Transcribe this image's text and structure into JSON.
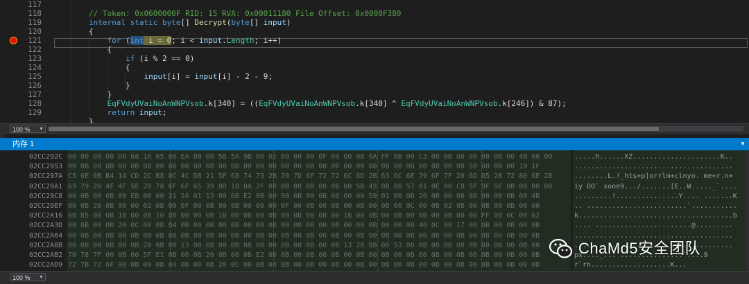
{
  "editor": {
    "lines": [
      {
        "num": "117",
        "tokens": []
      },
      {
        "num": "118",
        "tokens": [
          {
            "t": "// Token: 0x0600000F RID: 15 RVA: 0x00011180 File Offset: 0x0000F380",
            "c": "cm"
          }
        ]
      },
      {
        "num": "119",
        "tokens": [
          {
            "t": "internal static ",
            "c": "kw"
          },
          {
            "t": "byte",
            "c": "kw"
          },
          {
            "t": "[] ",
            "c": ""
          },
          {
            "t": "Decrypt",
            "c": "fn"
          },
          {
            "t": "(",
            "c": ""
          },
          {
            "t": "byte",
            "c": "kw"
          },
          {
            "t": "[] ",
            "c": ""
          },
          {
            "t": "input",
            "c": "id"
          },
          {
            "t": ")",
            "c": ""
          }
        ]
      },
      {
        "num": "120",
        "tokens": [
          {
            "t": "{",
            "c": ""
          }
        ]
      },
      {
        "num": "121",
        "tokens": [
          {
            "t": "    for ",
            "c": "kw"
          },
          {
            "t": "(",
            "c": ""
          },
          {
            "t": "int",
            "c": "kw hl"
          },
          {
            "t": " i = 0",
            "c": "hl2"
          },
          {
            "t": "; i < ",
            "c": ""
          },
          {
            "t": "input",
            "c": "id"
          },
          {
            "t": ".",
            "c": ""
          },
          {
            "t": "Length",
            "c": "ty"
          },
          {
            "t": "; i++)",
            "c": ""
          }
        ]
      },
      {
        "num": "122",
        "tokens": [
          {
            "t": "    {",
            "c": ""
          }
        ]
      },
      {
        "num": "123",
        "tokens": [
          {
            "t": "        if ",
            "c": "kw"
          },
          {
            "t": "(i % 2 == 0)",
            "c": ""
          }
        ]
      },
      {
        "num": "124",
        "tokens": [
          {
            "t": "        {",
            "c": ""
          }
        ]
      },
      {
        "num": "125",
        "tokens": [
          {
            "t": "            ",
            "c": ""
          },
          {
            "t": "input",
            "c": "id"
          },
          {
            "t": "[i] = ",
            "c": ""
          },
          {
            "t": "input",
            "c": "id"
          },
          {
            "t": "[i] - 2 - 9;",
            "c": ""
          }
        ]
      },
      {
        "num": "126",
        "tokens": [
          {
            "t": "        }",
            "c": ""
          }
        ]
      },
      {
        "num": "127",
        "tokens": [
          {
            "t": "    }",
            "c": ""
          }
        ]
      },
      {
        "num": "128",
        "tokens": [
          {
            "t": "    ",
            "c": ""
          },
          {
            "t": "EqFVdyUVaiNoAnWNPVsob",
            "c": "ty"
          },
          {
            "t": ".k[340] = ((",
            "c": ""
          },
          {
            "t": "EqFVdyUVaiNoAnWNPVsob",
            "c": "ty"
          },
          {
            "t": ".k[340] ^ ",
            "c": ""
          },
          {
            "t": "EqFVdyUVaiNoAnWNPVsob",
            "c": "ty"
          },
          {
            "t": ".k[246]) & 87);",
            "c": ""
          }
        ]
      },
      {
        "num": "129",
        "tokens": [
          {
            "t": "    return ",
            "c": "kw"
          },
          {
            "t": "input",
            "c": "id"
          },
          {
            "t": ";",
            "c": ""
          }
        ]
      },
      {
        "num": "",
        "tokens": [
          {
            "t": "}",
            "c": ""
          }
        ]
      }
    ]
  },
  "code_zoom": "100 %",
  "memory": {
    "title": "内存 1",
    "rows": [
      {
        "addr": "02CC292C",
        "hex": "00 00 00 00 D0 68 1A 05 00 EA 00 00 58 5A 9B 00 02 00 00 00 0F 00 00 0B 0A FF 0B 00 C3 00 0B 00 00 00 0B 00 48 00 00",
        "ascii": ".....h......XZ.....................K.."
      },
      {
        "addr": "02CC2953",
        "hex": "00 0B 00 0B 00 0B 00 00 0B 00 00 0B 00 0B 00 00 0B 00 00 0B 00 0B 00 00 00 0B 00 0B 00 0B 00 00 5B 00 0B 00 19 1F",
        "ascii": "......................................"
      },
      {
        "addr": "02CC297A",
        "ascii": "........L.!_hts+p]orrlm+clnyo. me+r.n+",
        "hex": "C5 0E 0B B4 14 CD 2C B8 0C 4C D8 21 5F 68 74 73 2B 70 7D 6F 72 72 6C 6D 2B 63 6C 6E 79 6F 7F 20 6D 65 2B 72 80 6E 2B"
      },
      {
        "addr": "02CC29A1",
        "hex": "69 79 20 4F 4F 5E 20 78 6F 6F 65 39 0D 18 0A 2F 00 0B 00 0B 00 0B 00 5B 45 0B 00 57 01 0E 00 C8 5F 9F 5E 0B 00 00 00",
        "ascii": "iy OO` xooe9.../.......[E..W....._`...."
      },
      {
        "addr": "02CC29C8",
        "hex": "00 0B 00 0B 00 EB 00 00 21 16 01 13 00 0B E2 0B 00 00 0B 00 0B 00 00 00 59 01 00 0B 20 0B 00 00 0B 00 00 0B 00 4B",
        "ascii": ".........!...............Y.... .......K"
      },
      {
        "addr": "02CC29EF",
        "hex": "00 0B 20 0B 00 00 02 0B 00 0F 00 0B 00 0B 00 00 00 0F 00 0B 00 0B 00 0B 00 0B 60 0C 00 0B 02 0B 00 0B 00 0B 00 00",
        "ascii": ".. ........................`..........."
      },
      {
        "addr": "02CC2A16",
        "hex": "6B 85 00 0B 1B 00 0B 10 0B 00 00 0B 1B 00 0B 00 0B 00 0B 00 0B 00 1B 00 0B 00 0B 00 0B 00 0B 00 00 FF 00 0C 00 62",
        "ascii": "k.....................................b"
      },
      {
        "addr": "02CC2A3D",
        "hex": "00 0B 00 0B 20 0C 00 0B 04 0B 00 0B 00 0B 00 00 0B 00 00 0B 00 0B 00 00 0B 00 00 0B 40 0C 00 17 00 0B 00 0B 00 0B",
        "ascii": ".... .......................@........."
      },
      {
        "addr": "02CC2A64",
        "hex": "00 0B 00 0B 00 0B 00 0B 00 0B 00 0B 00 0B 00 0B 00 0B 00 0B 00 0B 00 0B 00 0B 00 0B 00 0B 00 0B 00 0B 00 0B 00 0B",
        "ascii": "......................................"
      },
      {
        "addr": "02CC2A8B",
        "hex": "00 0B 00 0B 00 0B 20 0B 00 13 00 0B 00 0B 00 0B 00 0B 00 0B 00 0B 13 20 0B 00 53 00 0B 00 0B 00 0B 00 0B 00 0B 00",
        "ascii": "...... ............... ..S............"
      },
      {
        "addr": "02CC2AB2",
        "hex": "70 78 7F 00 0B 00 5F E1 0B 00 0B 20 0B 00 0B E2 00 0B 00 0B 00 0B 00 0B 00 0B 00 0B 00 0B 00 0B 00 0B 00 0B 00 0B",
        "ascii": "px...._... ...............`....9"
      },
      {
        "addr": "02CC2AD9",
        "hex": "72 7B 72 6F 00 0B 00 0B 04 0B 00 0B 20 0C 00 0B 04 0B 00 0B 00 0B 00 0B 00 0B 00 0B 00 0B 00 0B 00 0B 00 0B 00 0B",
        "ascii": "r`rn...................K..."
      }
    ]
  },
  "memory_zoom": "100 %",
  "watermark": {
    "text": "ChaMd5安全团队",
    "icon": "wechat-icon"
  }
}
